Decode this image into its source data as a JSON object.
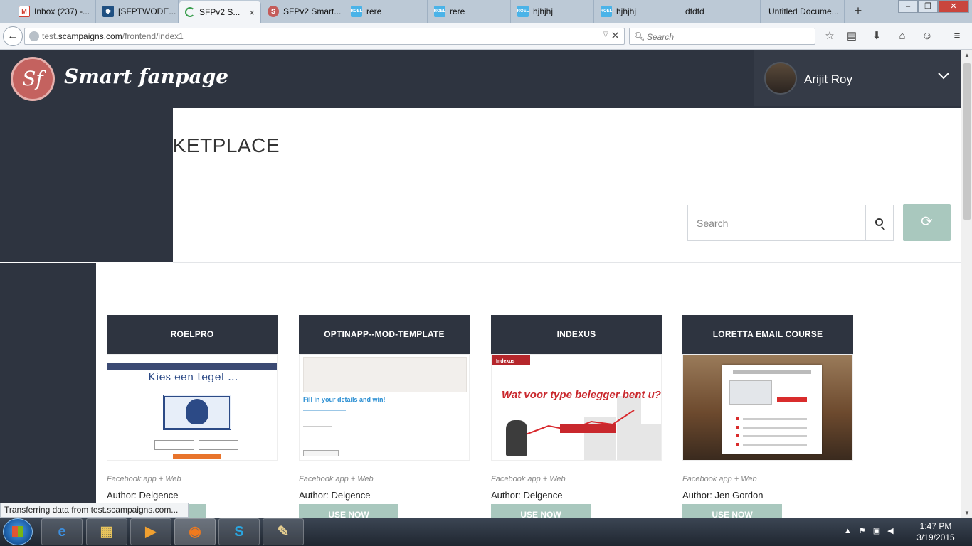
{
  "browser": {
    "tabs": [
      {
        "title": "Inbox (237) -...",
        "icon": "gmail-icon",
        "active": false
      },
      {
        "title": "[SFPTWODE...",
        "icon": "jira-icon",
        "active": false
      },
      {
        "title": "SFPv2 S...",
        "icon": "loading-icon",
        "active": true
      },
      {
        "title": "SFPv2 Smart...",
        "icon": "app-icon",
        "active": false
      },
      {
        "title": "rere",
        "icon": "roel-icon",
        "active": false
      },
      {
        "title": "rere",
        "icon": "roel-icon",
        "active": false
      },
      {
        "title": "hjhjhj",
        "icon": "roel-icon",
        "active": false
      },
      {
        "title": "hjhjhj",
        "icon": "roel-icon",
        "active": false
      },
      {
        "title": "dfdfd",
        "icon": "",
        "active": false
      },
      {
        "title": "Untitled Docume...",
        "icon": "",
        "active": false
      }
    ],
    "favicon_label": "ROEL",
    "tab_close": "×",
    "new_tab": "+",
    "url_prefix": "test.",
    "url_domain": "scampaigns.com",
    "url_path": "/frontend/index1",
    "search_placeholder": "Search",
    "status_text": "Transferring data from test.scampaigns.com...",
    "win": {
      "min": "–",
      "max": "❐",
      "close": "✕"
    }
  },
  "app": {
    "logo_text": "Sf",
    "brand": "Smart fanpage",
    "user_name": "Arijit Roy",
    "page_title": "MARKETPLACE",
    "search_placeholder": "Search",
    "reset_icon": "⟳"
  },
  "cards": [
    {
      "title": "ROELPRO",
      "type": "Facebook app + Web",
      "author": "Author: Delgence",
      "button": "USE NOW"
    },
    {
      "title": "OPTINAPP--MOD-TEMPLATE",
      "type": "Facebook app + Web",
      "author": "Author: Delgence",
      "button": "USE NOW"
    },
    {
      "title": "INDEXUS",
      "type": "Facebook app + Web",
      "author": "Author: Delgence",
      "button": "USE NOW"
    },
    {
      "title": "LORETTA EMAIL COURSE",
      "type": "Facebook app + Web",
      "author": "Author: Jen Gordon",
      "button": "USE NOW"
    }
  ],
  "thumbs": {
    "roelpro_title": "Kies een tegel ...",
    "optin_title": "Fill in your details and win!",
    "indexus_title": "Wat voor type belegger bent u?",
    "indexus_logo": "Indexus"
  },
  "taskbar": {
    "time": "1:47 PM",
    "date": "3/19/2015",
    "apps": [
      "ie-icon",
      "explorer-icon",
      "media-icon",
      "firefox-icon",
      "skype-icon",
      "paint-icon"
    ]
  }
}
